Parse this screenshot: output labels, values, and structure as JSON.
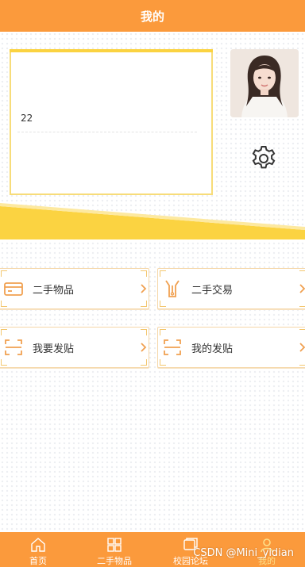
{
  "header": {
    "title": "我的"
  },
  "profile": {
    "user_value": "22"
  },
  "menu": [
    {
      "label": "二手物品",
      "icon": "card-icon"
    },
    {
      "label": "二手交易",
      "icon": "zipper-bag-icon"
    },
    {
      "label": "我要发贴",
      "icon": "scan-frame-icon"
    },
    {
      "label": "我的发贴",
      "icon": "scan-frame-icon"
    }
  ],
  "tabs": [
    {
      "label": "首页",
      "icon": "home-icon"
    },
    {
      "label": "二手物品",
      "icon": "grid-icon"
    },
    {
      "label": "校园论坛",
      "icon": "forum-icon"
    },
    {
      "label": "我的",
      "icon": "user-icon"
    }
  ],
  "watermark": "CSDN @Mini_yidian",
  "colors": {
    "primary": "#fb9a3c",
    "accent": "#fbd341",
    "icon": "#f0a050"
  }
}
